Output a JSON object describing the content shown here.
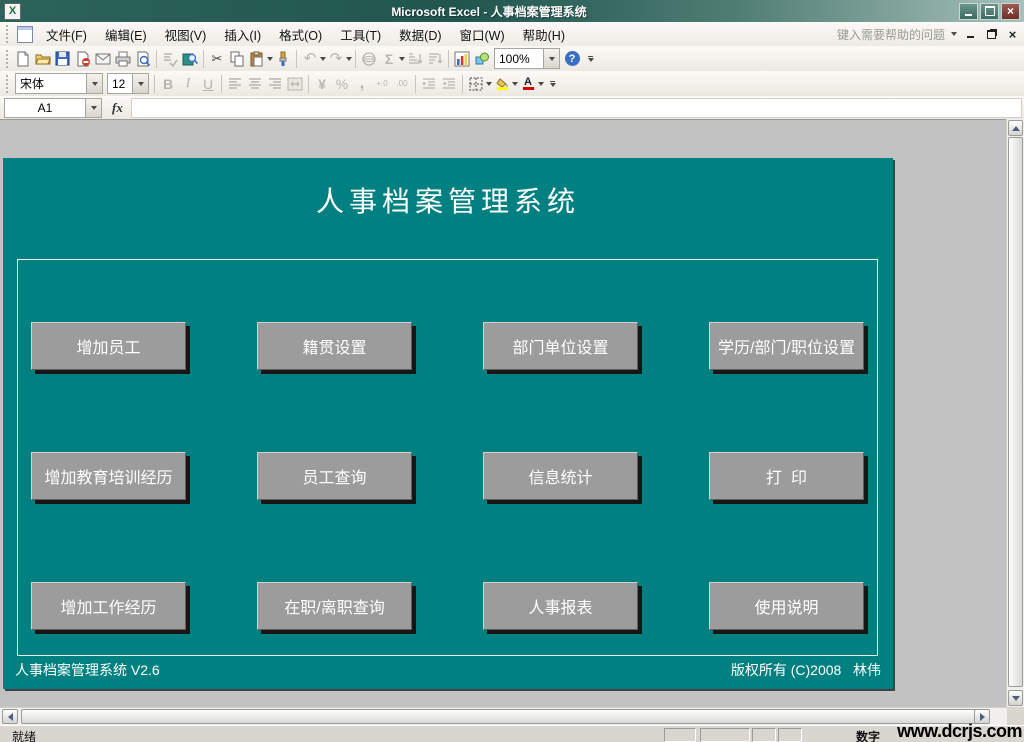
{
  "window": {
    "title": "Microsoft Excel - 人事档案管理系统"
  },
  "menu": {
    "items": [
      "文件(F)",
      "编辑(E)",
      "视图(V)",
      "插入(I)",
      "格式(O)",
      "工具(T)",
      "数据(D)",
      "窗口(W)",
      "帮助(H)"
    ],
    "help_placeholder": "键入需要帮助的问题"
  },
  "toolbar_standard": {
    "zoom_value": "100%",
    "icon_names": [
      "new",
      "open",
      "save",
      "permission",
      "mail",
      "print",
      "print-preview",
      "spelling",
      "research",
      "cut",
      "copy",
      "paste",
      "format-painter",
      "undo",
      "redo",
      "insert-hyperlink",
      "autosum",
      "sort-ascending",
      "sort-descending",
      "chart-wizard",
      "drawing",
      "zoom",
      "help",
      "toolbar-options"
    ]
  },
  "toolbar_formatting": {
    "font_name": "宋体",
    "font_size": "12",
    "icon_names": [
      "bold",
      "italic",
      "underline",
      "align-left",
      "align-center",
      "align-right",
      "merge-center",
      "currency",
      "percent",
      "comma",
      "increase-decimal",
      "decrease-decimal",
      "decrease-indent",
      "increase-indent",
      "borders",
      "fill-color",
      "font-color",
      "toolbar-options"
    ]
  },
  "formula_bar": {
    "name_box": "A1",
    "fx_label": "fx",
    "input_value": ""
  },
  "glyphs": {
    "excel_logo": "X",
    "close": "×",
    "cut": "✂",
    "undo": "↶",
    "redo": "↷",
    "autosum": "Σ",
    "help": "?",
    "bold": "B",
    "italic": "I",
    "underline": "U",
    "currency": "¥",
    "percent": "%",
    "comma": ",",
    "increase_decimal": "+.0",
    "decrease_decimal": ".00",
    "font_color": "A"
  },
  "panel": {
    "title": "人事档案管理系统",
    "buttons": [
      "增加员工",
      "籍贯设置",
      "部门单位设置",
      "学历/部门/职位设置",
      "增加教育培训经历",
      "员工查询",
      "信息统计",
      "打  印",
      "增加工作经历",
      "在职/离职查询",
      "人事报表",
      "使用说明"
    ],
    "footer_left": "人事档案管理系统 V2.6",
    "footer_right": "版权所有 (C)2008   林伟"
  },
  "status_bar": {
    "ready": "就绪",
    "num_lock": "数字"
  },
  "watermark": "www.dcrjs.com",
  "colors": {
    "panel_teal": "#008080",
    "titlebar_teal": "#20564e",
    "button_gray": "#9c9c9c",
    "fill_yellow": "#ffff00",
    "font_color_red": "#d40000"
  }
}
